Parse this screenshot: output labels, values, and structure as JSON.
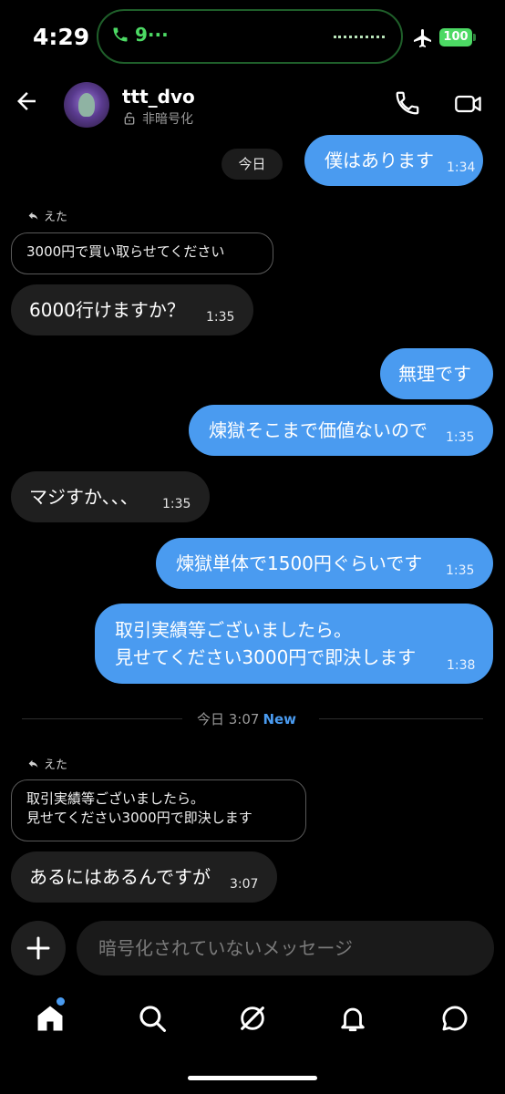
{
  "status": {
    "time": "4:29",
    "call": "9",
    "battery": "100"
  },
  "header": {
    "username": "ttt_dvo",
    "encryption": "非暗号化"
  },
  "date_chip": "今日",
  "messages": [
    {
      "text": "僕はあります",
      "time": "1:34"
    },
    {
      "reply_label": "えた",
      "quote": "3000円で買い取らせてください"
    },
    {
      "text": "6000行けますか？",
      "time": "1:35"
    },
    {
      "text": "無理です"
    },
    {
      "text": "煉獄そこまで価値ないので",
      "time": "1:35"
    },
    {
      "text": "マジすか、、、",
      "time": "1:35"
    },
    {
      "text": "煉獄単体で1500円ぐらいです",
      "time": "1:35"
    },
    {
      "line1": "取引実績等ございましたら。",
      "line2": "見せてください3000円で即決します",
      "time": "1:38"
    }
  ],
  "divider": {
    "text": "今日 3:07",
    "new": "New"
  },
  "reply2": {
    "label": "えた",
    "quote_line1": "取引実績等ございましたら。",
    "quote_line2": "見せてください3000円で即決します"
  },
  "last_message": {
    "text": "あるにはあるんですが",
    "time": "3:07"
  },
  "composer": {
    "placeholder": "暗号化されていないメッセージ"
  },
  "nav": {
    "icons": [
      "home-icon",
      "search-icon",
      "grok-icon",
      "notifications-icon",
      "messages-icon"
    ]
  },
  "colors": {
    "accent": "#4a9bf0",
    "incoming": "#1f1f1f",
    "call_green": "#4cd964"
  }
}
